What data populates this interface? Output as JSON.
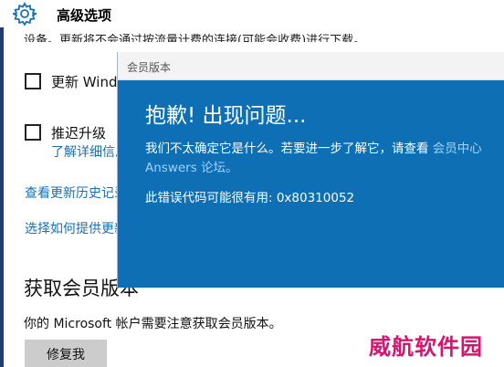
{
  "header": {
    "title": "高级选项",
    "icon": "gear-icon"
  },
  "settings": {
    "truncated_text": "设备。更新将不会通过按流量计费的连接(可能会收费)进行下载。",
    "checkbox1_label": "更新 Windows",
    "checkbox2_label": "推迟升级",
    "learn_more_link": "了解详细信息",
    "view_history_link": "查看更新历史记录",
    "choose_delivery_link": "选择如何提供更新",
    "section_title": "获取会员版本",
    "section_desc": "你的 Microsoft 帐户需要注意获取会员版本。",
    "fix_button": "修复我"
  },
  "dialog": {
    "titlebar": "会员版本",
    "heading": "抱歉! 出现问题...",
    "message_line1": "我们不太确定它是什么。若要进一步了解它，请查看",
    "message_link": "会员中心",
    "message_line2": "Answers 论坛。",
    "error_code_text": "此错误代码可能很有用: 0x80310052"
  },
  "watermark": "威航软件园",
  "colors": {
    "dialog_bg": "#0e6fb5",
    "link": "#1a6fb5",
    "watermark": "#d8146f"
  }
}
